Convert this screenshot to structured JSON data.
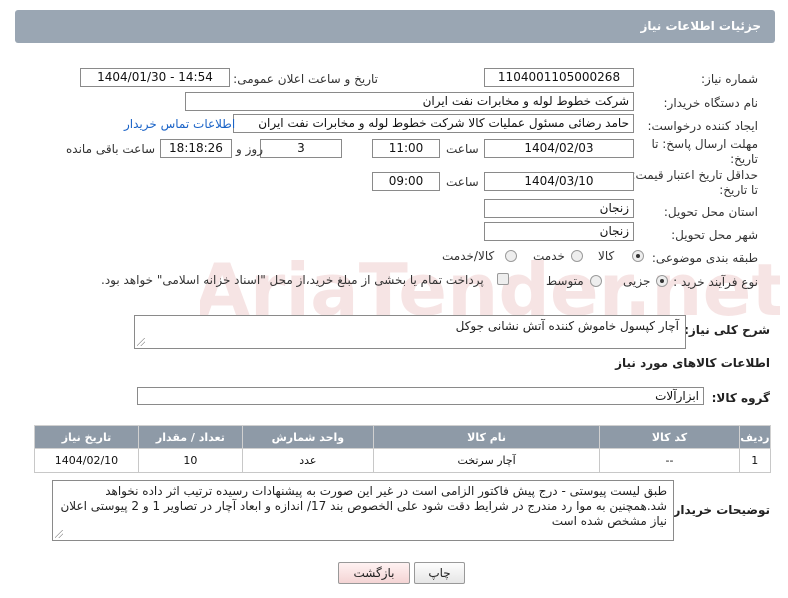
{
  "header": {
    "title": "جزئیات اطلاعات نیاز"
  },
  "fields": {
    "need_number": {
      "label": "شماره نیاز:",
      "value": "1104001105000268"
    },
    "announce_datetime": {
      "label": "تاریخ و ساعت اعلان عمومی:",
      "value": "1404/01/30 - 14:54"
    },
    "buyer_org": {
      "label": "نام دستگاه خریدار:",
      "value": "شرکت خطوط لوله و مخابرات نفت ایران"
    },
    "requester": {
      "label": "ایجاد کننده درخواست:",
      "value": "حامد  رضائی  مسئول عملیات کالا  شرکت خطوط لوله و مخابرات نفت ایران",
      "contact_link": "اطلاعات تماس خریدار"
    },
    "reply_deadline": {
      "label_line1": "مهلت ارسال پاسخ: تا",
      "label_line2": "تاریخ:",
      "date": "1404/02/03",
      "time_label": "ساعت",
      "time": "11:00",
      "days": "3",
      "days_label": "روز و",
      "remaining": "18:18:26",
      "remaining_label": "ساعت باقی مانده"
    },
    "price_validity": {
      "label_line1": "حداقل تاریخ اعتبار قیمت:",
      "label_line2": "تا تاریخ:",
      "date": "1404/03/10",
      "time_label": "ساعت",
      "time": "09:00"
    },
    "delivery_province": {
      "label": "استان محل تحویل:",
      "value": "زنجان"
    },
    "delivery_city": {
      "label": "شهر محل تحویل:",
      "value": "زنجان"
    },
    "subject_category": {
      "label": "طبقه بندی موضوعی:",
      "options": [
        "کالا",
        "خدمت",
        "کالا/خدمت"
      ],
      "selected": "کالا"
    },
    "purchase_process": {
      "label": "نوع فرآیند خرید :",
      "options": [
        "جزیی",
        "متوسط"
      ],
      "selected": "جزیی",
      "payment_note": "پرداخت تمام یا بخشی از مبلغ خرید،از محل \"اسناد خزانه اسلامی\" خواهد بود."
    }
  },
  "description": {
    "label": "شرح کلی نیاز:",
    "value": "آچار کپسول خاموش کننده آتش نشانی جوکل"
  },
  "goods_section": {
    "title": "اطلاعات کالاهای مورد نیاز",
    "group_label": "گروه کالا:",
    "group_value": "ابزارآلات"
  },
  "items_table": {
    "columns": [
      "ردیف",
      "کد کالا",
      "نام کالا",
      "واحد شمارش",
      "تعداد / مقدار",
      "تاریخ نیاز"
    ],
    "rows": [
      [
        "1",
        "--",
        "آچار سرتخت",
        "عدد",
        "10",
        "1404/02/10"
      ]
    ]
  },
  "buyer_notes": {
    "label": "توضیحات خریدار:",
    "value": "طبق لیست پیوستی - درج پیش فاکتور الزامی است در غیر این صورت به پیشنهادات رسیده ترتیب اثر داده نخواهد شد.همچنین به موا رد مندرج در شرایط دقت شود علی الخصوص بند 17/  اندازه و ابعاد آچار در تصاویر 1 و 2 پیوستی اعلان نیاز مشخص شده است"
  },
  "buttons": {
    "print": "چاپ",
    "back": "بازگشت"
  },
  "watermark": {
    "text": "AriaTender.net"
  },
  "colors": {
    "header_bg": "#9aa6b3",
    "table_header_bg": "#8e9aa7",
    "link": "#1a63c7",
    "back_button_bg": "#f4d4d4"
  }
}
